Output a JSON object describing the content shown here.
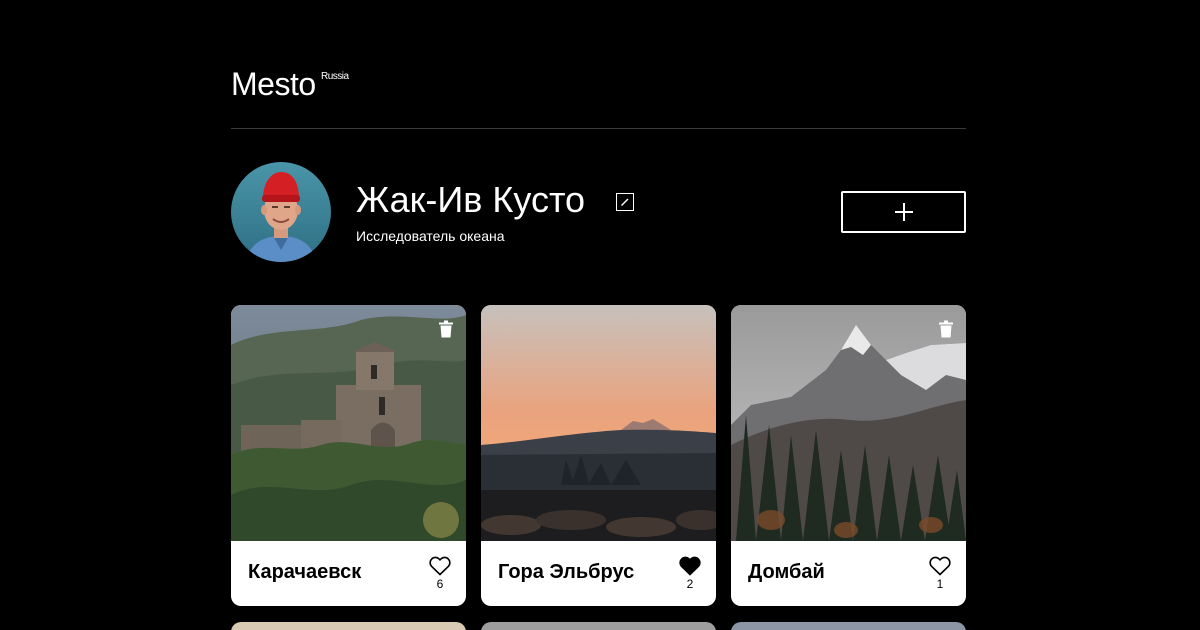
{
  "header": {
    "logo_text": "Mesto",
    "logo_superscript": "Russia"
  },
  "profile": {
    "name": "Жак-Ив Кусто",
    "about": "Исследователь океана",
    "avatar_icon": "avatar-photo",
    "edit_icon": "pencil-icon",
    "add_icon": "plus-icon"
  },
  "cards": [
    {
      "title": "Карачаевск",
      "likes": "6",
      "liked": false,
      "deletable": true
    },
    {
      "title": "Гора Эльбрус",
      "likes": "2",
      "liked": true,
      "deletable": false
    },
    {
      "title": "Домбай",
      "likes": "1",
      "liked": false,
      "deletable": true
    }
  ],
  "colors": {
    "background": "#000000",
    "text": "#ffffff",
    "card_background": "#ffffff",
    "card_text": "#000000",
    "divider": "#545454"
  }
}
